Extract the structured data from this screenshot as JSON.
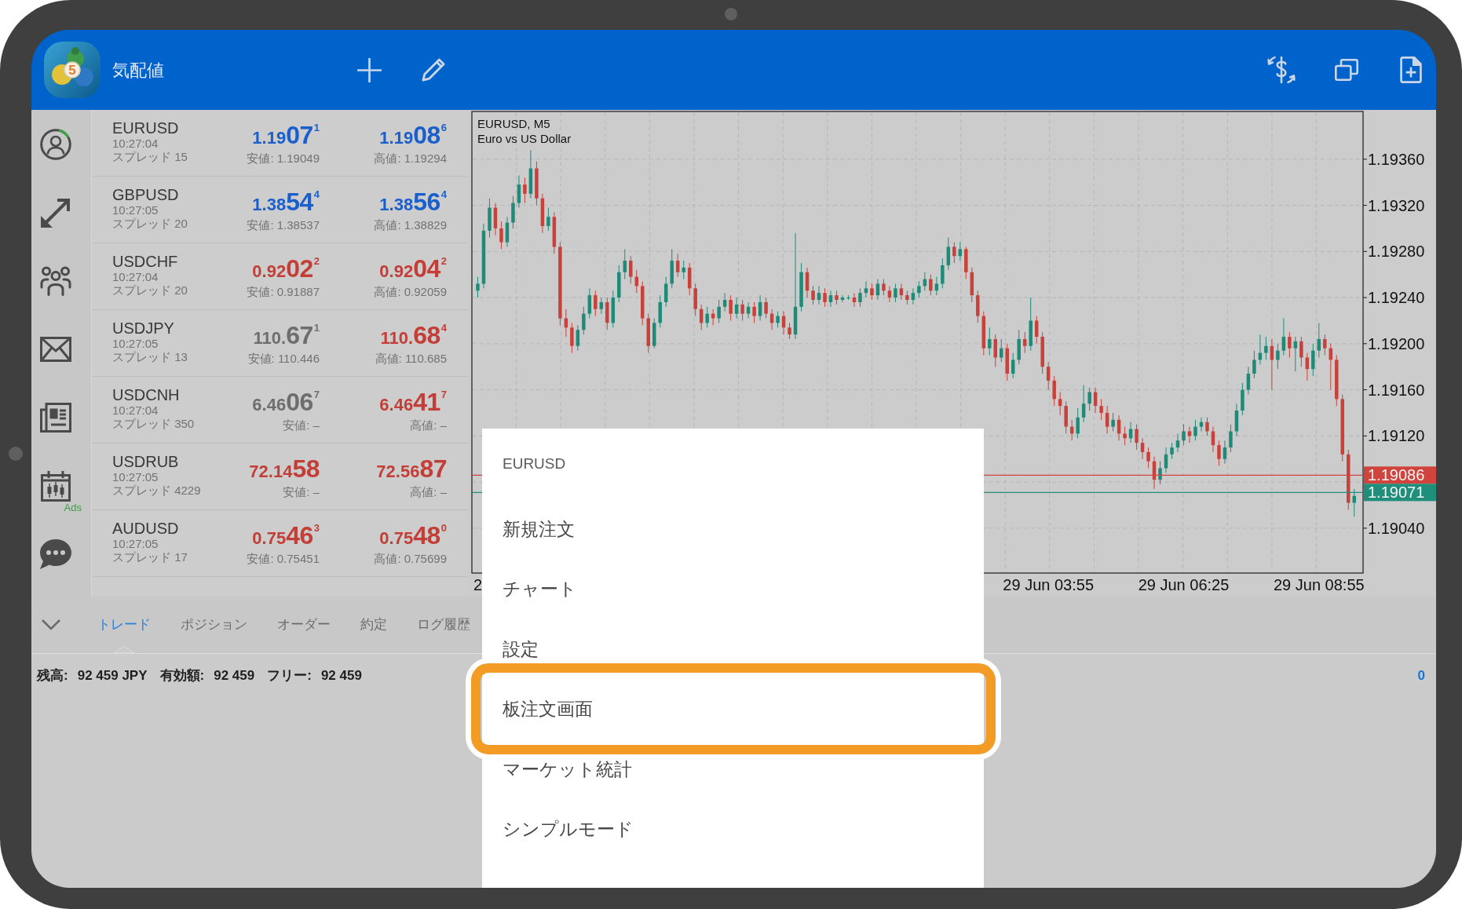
{
  "header": {
    "title": "気配値",
    "logo_mark": "5"
  },
  "sidebar": {
    "badge": "Ads"
  },
  "quotes": [
    {
      "symbol": "EURUSD",
      "time": "10:27:04",
      "spread": "スプレッド 15",
      "bid": {
        "prefix": "1.19",
        "big": "07",
        "sup": "1",
        "color": "#1a5fcb"
      },
      "low": "安値: 1.19049",
      "ask": {
        "prefix": "1.19",
        "big": "08",
        "sup": "6",
        "color": "#1a5fcb"
      },
      "high": "高値: 1.19294"
    },
    {
      "symbol": "GBPUSD",
      "time": "10:27:05",
      "spread": "スプレッド 20",
      "bid": {
        "prefix": "1.38",
        "big": "54",
        "sup": "4",
        "color": "#1a5fcb"
      },
      "low": "安値: 1.38537",
      "ask": {
        "prefix": "1.38",
        "big": "56",
        "sup": "4",
        "color": "#1a5fcb"
      },
      "high": "高値: 1.38829"
    },
    {
      "symbol": "USDCHF",
      "time": "10:27:04",
      "spread": "スプレッド 20",
      "bid": {
        "prefix": "0.92",
        "big": "02",
        "sup": "2",
        "color": "#c33e37"
      },
      "low": "安値: 0.91887",
      "ask": {
        "prefix": "0.92",
        "big": "04",
        "sup": "2",
        "color": "#c33e37"
      },
      "high": "高値: 0.92059"
    },
    {
      "symbol": "USDJPY",
      "time": "10:27:05",
      "spread": "スプレッド 13",
      "bid": {
        "prefix": "110.",
        "big": "67",
        "sup": "1",
        "color": "#6e6e6e"
      },
      "low": "安値: 110.446",
      "ask": {
        "prefix": "110.",
        "big": "68",
        "sup": "4",
        "color": "#c33e37"
      },
      "high": "高値: 110.685"
    },
    {
      "symbol": "USDCNH",
      "time": "10:27:04",
      "spread": "スプレッド 350",
      "bid": {
        "prefix": "6.46",
        "big": "06",
        "sup": "7",
        "color": "#6e6e6e"
      },
      "low": "安値: –",
      "ask": {
        "prefix": "6.46",
        "big": "41",
        "sup": "7",
        "color": "#c33e37"
      },
      "high": "高値: –"
    },
    {
      "symbol": "USDRUB",
      "time": "10:27:05",
      "spread": "スプレッド 4229",
      "bid": {
        "prefix": "72.14",
        "big": "58",
        "color": "#c33e37"
      },
      "low": "安値: –",
      "ask": {
        "prefix": "72.56",
        "big": "87",
        "color": "#c33e37"
      },
      "high": "高値: –"
    },
    {
      "symbol": "AUDUSD",
      "time": "10:27:05",
      "spread": "スプレッド 17",
      "bid": {
        "prefix": "0.75",
        "big": "46",
        "sup": "3",
        "color": "#c33e37"
      },
      "low": "安値: 0.75451",
      "ask": {
        "prefix": "0.75",
        "big": "48",
        "sup": "0",
        "color": "#c33e37"
      },
      "high": "高値: 0.75699"
    }
  ],
  "chart": {
    "subtitle": "Euro vs US Dollar",
    "chart_data": {
      "type": "candlestick",
      "title": "EURUSD, M5",
      "grid": true,
      "ylim": [
        1.190011,
        1.194014
      ],
      "categories": [
        "2",
        null,
        null,
        null,
        null,
        null,
        null,
        null,
        null,
        null,
        null,
        null,
        null,
        null,
        null,
        null,
        null,
        null,
        null,
        null,
        null,
        null,
        null,
        null,
        null,
        null,
        null,
        null,
        null,
        null,
        null,
        null,
        null,
        null,
        null,
        null,
        null,
        null,
        null,
        null,
        null,
        null,
        null,
        null,
        null,
        null,
        null,
        null,
        null,
        null,
        null,
        null,
        null,
        null,
        null,
        null,
        null,
        null,
        null,
        null,
        null,
        null,
        null,
        null,
        null,
        null,
        null,
        null,
        null,
        null,
        null,
        null,
        null,
        null,
        null,
        null,
        null,
        null,
        null,
        null,
        null,
        null,
        null,
        null,
        null,
        null,
        null,
        null,
        null,
        null,
        null,
        null,
        null,
        null,
        null,
        null,
        null,
        "29 Jun 03:55",
        null,
        null,
        null,
        null,
        null,
        null,
        null,
        null,
        null,
        null,
        null,
        null,
        null,
        null,
        null,
        null,
        null,
        null,
        null,
        null,
        null,
        null,
        "29 Jun 06:25",
        null,
        null,
        null,
        null,
        null,
        null,
        null,
        null,
        null,
        null,
        null,
        null,
        null,
        null,
        null,
        null,
        null,
        null,
        null,
        null,
        null,
        null,
        "29 Jun 08:55",
        null,
        null,
        null,
        null,
        null,
        null
      ],
      "yticks": [
        {
          "value": 1.1936,
          "label": "1.19360"
        },
        {
          "value": 1.1932,
          "label": "1.19320"
        },
        {
          "value": 1.1928,
          "label": "1.19280"
        },
        {
          "value": 1.1924,
          "label": "1.19240"
        },
        {
          "value": 1.192,
          "label": "1.19200"
        },
        {
          "value": 1.1916,
          "label": "1.19160"
        },
        {
          "value": 1.1912,
          "label": "1.19120"
        },
        {
          "value": 1.1904,
          "label": "1.19040"
        }
      ],
      "ref_lines": [
        {
          "axis": "y",
          "value": 1.19086,
          "label": "1.19086",
          "color": "#d1443d"
        },
        {
          "axis": "y",
          "value": 1.19071,
          "label": "1.19071",
          "color": "#1f8f7b"
        }
      ],
      "ohlc": [
        [
          1.19246,
          1.19258,
          1.1924,
          1.19252
        ],
        [
          1.19252,
          1.19304,
          1.19248,
          1.19298
        ],
        [
          1.19298,
          1.19326,
          1.19292,
          1.19318
        ],
        [
          1.19318,
          1.19322,
          1.19294,
          1.193
        ],
        [
          1.193,
          1.19306,
          1.19282,
          1.19288
        ],
        [
          1.19288,
          1.1931,
          1.19284,
          1.19305
        ],
        [
          1.19305,
          1.19328,
          1.193,
          1.19322
        ],
        [
          1.19322,
          1.19346,
          1.19318,
          1.19338
        ],
        [
          1.19338,
          1.19344,
          1.19322,
          1.1933
        ],
        [
          1.1933,
          1.19368,
          1.19326,
          1.19352
        ],
        [
          1.19352,
          1.19358,
          1.1932,
          1.19326
        ],
        [
          1.19326,
          1.1933,
          1.19296,
          1.19302
        ],
        [
          1.19302,
          1.19318,
          1.19298,
          1.1931
        ],
        [
          1.1931,
          1.19314,
          1.19278,
          1.19284
        ],
        [
          1.19284,
          1.19288,
          1.19216,
          1.19222
        ],
        [
          1.19222,
          1.1923,
          1.19206,
          1.19214
        ],
        [
          1.19214,
          1.19218,
          1.19192,
          1.19198
        ],
        [
          1.19198,
          1.19216,
          1.19194,
          1.19212
        ],
        [
          1.19212,
          1.19232,
          1.19208,
          1.19226
        ],
        [
          1.19226,
          1.19248,
          1.19222,
          1.19242
        ],
        [
          1.19242,
          1.19246,
          1.19224,
          1.1923
        ],
        [
          1.1923,
          1.1924,
          1.19226,
          1.19236
        ],
        [
          1.19236,
          1.1924,
          1.19212,
          1.19218
        ],
        [
          1.19218,
          1.19246,
          1.19214,
          1.1924
        ],
        [
          1.1924,
          1.19268,
          1.19236,
          1.19262
        ],
        [
          1.19262,
          1.19282,
          1.19256,
          1.19272
        ],
        [
          1.19272,
          1.19276,
          1.19252,
          1.19258
        ],
        [
          1.19258,
          1.19264,
          1.19244,
          1.1925
        ],
        [
          1.1925,
          1.19254,
          1.19216,
          1.19222
        ],
        [
          1.19222,
          1.19226,
          1.19192,
          1.19198
        ],
        [
          1.19198,
          1.19222,
          1.19196,
          1.19218
        ],
        [
          1.19218,
          1.19242,
          1.19214,
          1.19236
        ],
        [
          1.19236,
          1.19258,
          1.19232,
          1.19252
        ],
        [
          1.19252,
          1.19282,
          1.19248,
          1.19272
        ],
        [
          1.19272,
          1.19278,
          1.19258,
          1.19262
        ],
        [
          1.19262,
          1.19272,
          1.19256,
          1.19266
        ],
        [
          1.19266,
          1.1927,
          1.19242,
          1.19248
        ],
        [
          1.19248,
          1.19252,
          1.19224,
          1.1923
        ],
        [
          1.1923,
          1.19234,
          1.19212,
          1.19218
        ],
        [
          1.19218,
          1.19232,
          1.19214,
          1.19226
        ],
        [
          1.19226,
          1.1923,
          1.19216,
          1.19222
        ],
        [
          1.19222,
          1.19238,
          1.19218,
          1.19232
        ],
        [
          1.19232,
          1.19244,
          1.19228,
          1.19238
        ],
        [
          1.19238,
          1.19242,
          1.1922,
          1.19226
        ],
        [
          1.19226,
          1.1924,
          1.19222,
          1.19234
        ],
        [
          1.19234,
          1.19238,
          1.1922,
          1.19226
        ],
        [
          1.19226,
          1.19236,
          1.19222,
          1.19232
        ],
        [
          1.19232,
          1.19236,
          1.19218,
          1.19224
        ],
        [
          1.19224,
          1.19242,
          1.1922,
          1.19236
        ],
        [
          1.19236,
          1.1924,
          1.19222,
          1.19226
        ],
        [
          1.19226,
          1.1923,
          1.19212,
          1.19218
        ],
        [
          1.19218,
          1.19228,
          1.19214,
          1.19224
        ],
        [
          1.19224,
          1.19228,
          1.19208,
          1.19214
        ],
        [
          1.19214,
          1.19218,
          1.19204,
          1.19208
        ],
        [
          1.19208,
          1.19296,
          1.19204,
          1.19232
        ],
        [
          1.19232,
          1.1927,
          1.19228,
          1.19262
        ],
        [
          1.19262,
          1.19266,
          1.1924,
          1.19246
        ],
        [
          1.19246,
          1.1925,
          1.19234,
          1.19238
        ],
        [
          1.19238,
          1.1925,
          1.19234,
          1.19244
        ],
        [
          1.19244,
          1.19248,
          1.19232,
          1.19236
        ],
        [
          1.19236,
          1.19246,
          1.19232,
          1.19242
        ],
        [
          1.19242,
          1.19246,
          1.19234,
          1.19238
        ],
        [
          1.19238,
          1.19242,
          1.19236,
          1.1924
        ],
        [
          1.1924,
          1.19242,
          1.19238,
          1.1924
        ],
        [
          1.1924,
          1.19244,
          1.19232,
          1.19236
        ],
        [
          1.19236,
          1.19248,
          1.19232,
          1.19244
        ],
        [
          1.19244,
          1.19254,
          1.1924,
          1.19248
        ],
        [
          1.19248,
          1.19252,
          1.19238,
          1.19242
        ],
        [
          1.19242,
          1.19256,
          1.19238,
          1.19252
        ],
        [
          1.19252,
          1.19256,
          1.19242,
          1.19246
        ],
        [
          1.19246,
          1.1925,
          1.19236,
          1.1924
        ],
        [
          1.1924,
          1.19252,
          1.19236,
          1.19248
        ],
        [
          1.19248,
          1.19252,
          1.19238,
          1.19242
        ],
        [
          1.19242,
          1.19246,
          1.19234,
          1.19238
        ],
        [
          1.19238,
          1.19248,
          1.19234,
          1.19244
        ],
        [
          1.19244,
          1.19254,
          1.1924,
          1.1925
        ],
        [
          1.1925,
          1.19262,
          1.19246,
          1.19256
        ],
        [
          1.19256,
          1.1926,
          1.19242,
          1.19246
        ],
        [
          1.19246,
          1.19258,
          1.19242,
          1.19252
        ],
        [
          1.19252,
          1.19274,
          1.19248,
          1.19268
        ],
        [
          1.19268,
          1.19292,
          1.19264,
          1.19284
        ],
        [
          1.19284,
          1.19288,
          1.1927,
          1.19276
        ],
        [
          1.19276,
          1.19288,
          1.19272,
          1.19282
        ],
        [
          1.19282,
          1.19284,
          1.19256,
          1.19262
        ],
        [
          1.19262,
          1.19266,
          1.19236,
          1.19242
        ],
        [
          1.19242,
          1.19246,
          1.19218,
          1.19224
        ],
        [
          1.19224,
          1.19228,
          1.1919,
          1.19196
        ],
        [
          1.19196,
          1.19214,
          1.1919,
          1.19204
        ],
        [
          1.19204,
          1.19208,
          1.1918,
          1.19188
        ],
        [
          1.19188,
          1.19204,
          1.19184,
          1.19196
        ],
        [
          1.19196,
          1.192,
          1.19168,
          1.19174
        ],
        [
          1.19174,
          1.19192,
          1.1917,
          1.19186
        ],
        [
          1.19186,
          1.19212,
          1.19182,
          1.19204
        ],
        [
          1.19204,
          1.1921,
          1.19192,
          1.19198
        ],
        [
          1.19198,
          1.1924,
          1.19194,
          1.1922
        ],
        [
          1.1922,
          1.19224,
          1.192,
          1.19206
        ],
        [
          1.19206,
          1.1921,
          1.19174,
          1.1918
        ],
        [
          1.1918,
          1.19184,
          1.1916,
          1.19168
        ],
        [
          1.19168,
          1.19172,
          1.19146,
          1.19152
        ],
        [
          1.19152,
          1.19158,
          1.19138,
          1.19146
        ],
        [
          1.19146,
          1.1915,
          1.19122,
          1.19128
        ],
        [
          1.19128,
          1.19134,
          1.19116,
          1.19122
        ],
        [
          1.19122,
          1.19144,
          1.19118,
          1.19136
        ],
        [
          1.19136,
          1.19164,
          1.19132,
          1.19148
        ],
        [
          1.19148,
          1.19162,
          1.19142,
          1.19158
        ],
        [
          1.19158,
          1.19162,
          1.1914,
          1.19146
        ],
        [
          1.19146,
          1.19152,
          1.19134,
          1.1914
        ],
        [
          1.1914,
          1.19146,
          1.19122,
          1.19128
        ],
        [
          1.19128,
          1.1914,
          1.19124,
          1.19134
        ],
        [
          1.19134,
          1.19138,
          1.19116,
          1.19122
        ],
        [
          1.19122,
          1.19128,
          1.19112,
          1.19118
        ],
        [
          1.19118,
          1.19132,
          1.19114,
          1.19126
        ],
        [
          1.19126,
          1.1913,
          1.19108,
          1.19114
        ],
        [
          1.19114,
          1.19118,
          1.191,
          1.19106
        ],
        [
          1.19106,
          1.1911,
          1.19092,
          1.19098
        ],
        [
          1.19098,
          1.19102,
          1.19074,
          1.19082
        ],
        [
          1.19082,
          1.19098,
          1.19078,
          1.19092
        ],
        [
          1.19092,
          1.1911,
          1.19088,
          1.19104
        ],
        [
          1.19104,
          1.19114,
          1.191,
          1.1911
        ],
        [
          1.1911,
          1.19122,
          1.19106,
          1.19116
        ],
        [
          1.19116,
          1.1913,
          1.19112,
          1.19124
        ],
        [
          1.19124,
          1.19128,
          1.19114,
          1.1912
        ],
        [
          1.1912,
          1.19134,
          1.19116,
          1.19128
        ],
        [
          1.19128,
          1.19136,
          1.19124,
          1.19132
        ],
        [
          1.19132,
          1.19136,
          1.1912,
          1.19124
        ],
        [
          1.19124,
          1.19128,
          1.19106,
          1.19112
        ],
        [
          1.19112,
          1.19116,
          1.19094,
          1.191
        ],
        [
          1.191,
          1.19116,
          1.19096,
          1.1911
        ],
        [
          1.1911,
          1.1913,
          1.19106,
          1.19124
        ],
        [
          1.19124,
          1.19148,
          1.1912,
          1.19142
        ],
        [
          1.19142,
          1.19166,
          1.19138,
          1.1916
        ],
        [
          1.1916,
          1.1918,
          1.19156,
          1.19174
        ],
        [
          1.19174,
          1.19194,
          1.1917,
          1.19186
        ],
        [
          1.19186,
          1.19208,
          1.19182,
          1.19192
        ],
        [
          1.19192,
          1.19206,
          1.19186,
          1.19198
        ],
        [
          1.19198,
          1.19204,
          1.1916,
          1.19186
        ],
        [
          1.19186,
          1.192,
          1.19178,
          1.19194
        ],
        [
          1.19194,
          1.19222,
          1.1919,
          1.19206
        ],
        [
          1.19206,
          1.1921,
          1.19188,
          1.19196
        ],
        [
          1.19196,
          1.19206,
          1.19176,
          1.19202
        ],
        [
          1.19202,
          1.19206,
          1.1918,
          1.19188
        ],
        [
          1.19188,
          1.19192,
          1.19168,
          1.19178
        ],
        [
          1.19178,
          1.192,
          1.19172,
          1.19194
        ],
        [
          1.19194,
          1.19218,
          1.19188,
          1.19204
        ],
        [
          1.19204,
          1.19208,
          1.1919,
          1.19196
        ],
        [
          1.19196,
          1.192,
          1.1916,
          1.19186
        ],
        [
          1.19186,
          1.1919,
          1.19146,
          1.19152
        ],
        [
          1.19152,
          1.19156,
          1.19098,
          1.19104
        ],
        [
          1.19104,
          1.19108,
          1.19056,
          1.19062
        ],
        [
          1.19062,
          1.19074,
          1.1905,
          1.19068
        ]
      ]
    }
  },
  "tabs": [
    {
      "label": "トレード",
      "selected": true
    },
    {
      "label": "ポジション",
      "selected": false
    },
    {
      "label": "オーダー",
      "selected": false
    },
    {
      "label": "約定",
      "selected": false
    },
    {
      "label": "ログ履歴",
      "selected": false
    }
  ],
  "account": {
    "items": [
      {
        "label": "残高:",
        "value": "92 459 JPY"
      },
      {
        "label": "有効額:",
        "value": "92 459"
      },
      {
        "label": "フリー:",
        "value": "92 459"
      }
    ],
    "total": "0"
  },
  "menu": {
    "title": "EURUSD",
    "items": [
      {
        "label": "新規注文",
        "highlighted": false
      },
      {
        "label": "チャート",
        "highlighted": false
      },
      {
        "label": "設定",
        "highlighted": false
      },
      {
        "label": "板注文画面",
        "highlighted": true
      },
      {
        "label": "マーケット統計",
        "highlighted": false
      },
      {
        "label": "シンプルモード",
        "highlighted": false
      }
    ]
  }
}
